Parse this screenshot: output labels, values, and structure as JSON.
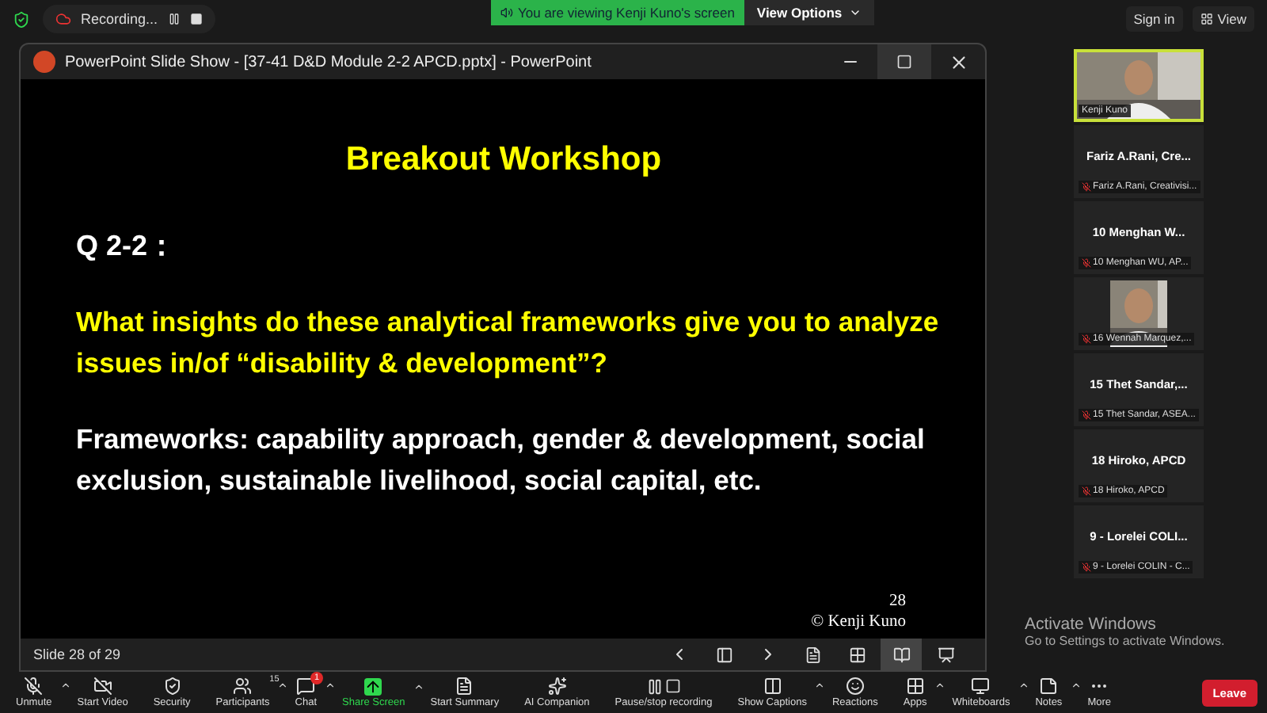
{
  "top_bar": {
    "recording": "Recording...",
    "banner": "You are viewing Kenji Kuno's screen",
    "view_options": "View Options",
    "sign_in": "Sign in",
    "view": "View"
  },
  "ppt_window": {
    "title": "PowerPoint Slide Show - [37-41 D&D Module 2-2 APCD.pptx] - PowerPoint",
    "slide": {
      "heading": "Breakout Workshop",
      "question_number": "Q 2-2：",
      "question": "What insights do these analytical frameworks give you to analyze issues in/of “disability & development”?",
      "frameworks": "Frameworks: capability approach, gender & development, social exclusion, sustainable livelihood, social capital, etc.",
      "page_number": "28",
      "copyright": "© Kenji Kuno"
    },
    "status": "Slide 28 of 29"
  },
  "participants": [
    {
      "kind": "video",
      "label": "Kenji Kuno",
      "speaking": true,
      "muted": false
    },
    {
      "kind": "name",
      "name": "Fariz A.Rani, Cre...",
      "label": "Fariz A.Rani, Creativisi...",
      "speaking": false,
      "muted": true
    },
    {
      "kind": "name",
      "name": "10 Menghan W...",
      "label": "10 Menghan WU, AP...",
      "speaking": false,
      "muted": true
    },
    {
      "kind": "video",
      "label": "16 Wennah Marquez,...",
      "speaking": false,
      "muted": true
    },
    {
      "kind": "name",
      "name": "15 Thet Sandar,...",
      "label": "15 Thet Sandar, ASEA...",
      "speaking": false,
      "muted": true
    },
    {
      "kind": "name",
      "name": "18 Hiroko, APCD",
      "label": "18 Hiroko, APCD",
      "speaking": false,
      "muted": true
    },
    {
      "kind": "name",
      "name": "9 - Lorelei COLI...",
      "label": "9 - Lorelei COLIN - C...",
      "speaking": false,
      "muted": true
    }
  ],
  "toolbar": [
    {
      "kind": "unmute",
      "label": "Unmute",
      "caret": true
    },
    {
      "kind": "video",
      "label": "Start Video",
      "caret": false
    },
    {
      "kind": "security",
      "label": "Security",
      "caret": false
    },
    {
      "kind": "participants",
      "label": "Participants",
      "count": "15",
      "caret": true
    },
    {
      "kind": "chat",
      "label": "Chat",
      "badge": "1",
      "caret": true
    },
    {
      "kind": "share",
      "label": "Share Screen",
      "caret": true
    },
    {
      "kind": "summary",
      "label": "Start Summary",
      "caret": false
    },
    {
      "kind": "ai",
      "label": "AI Companion",
      "caret": false
    },
    {
      "kind": "record",
      "label": "Pause/stop recording",
      "caret": false
    },
    {
      "kind": "captions",
      "label": "Show Captions",
      "caret": true
    },
    {
      "kind": "reactions",
      "label": "Reactions",
      "caret": false
    },
    {
      "kind": "apps",
      "label": "Apps",
      "caret": true
    },
    {
      "kind": "whiteboards",
      "label": "Whiteboards",
      "caret": true
    },
    {
      "kind": "notes",
      "label": "Notes",
      "caret": true
    },
    {
      "kind": "more",
      "label": "More",
      "caret": false
    }
  ],
  "leave": "Leave",
  "activation": {
    "title": "Activate Windows",
    "subtitle": "Go to Settings to activate Windows."
  }
}
